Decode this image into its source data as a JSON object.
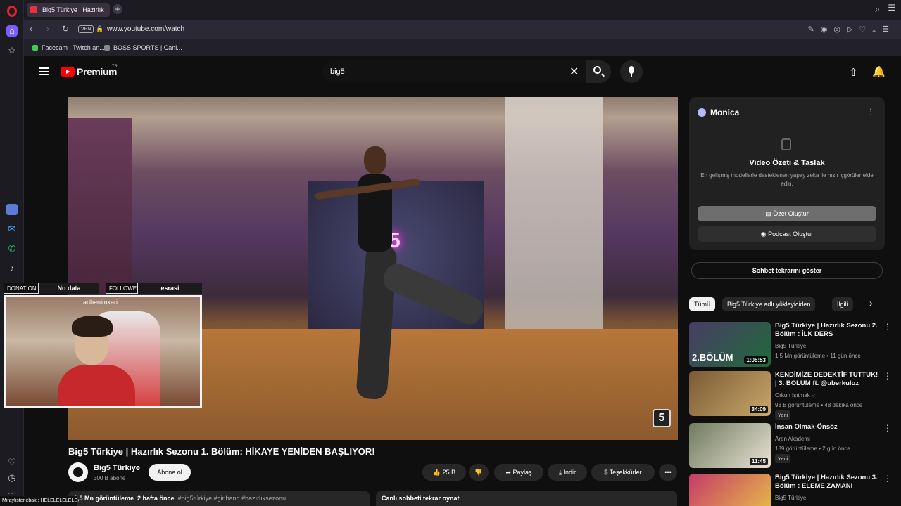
{
  "browser": {
    "tab_title": "Big5 Türkiye | Hazırlık",
    "vpn_label": "VPN",
    "url": "www.youtube.com/watch",
    "bookmarks": [
      {
        "label": "Facecam | Twitch an...",
        "color": "#3ccf4e"
      },
      {
        "label": "BOSS SPORTS | Canl...",
        "color": "#888888"
      }
    ]
  },
  "youtube": {
    "logo_text": "Premium",
    "logo_region": "TR",
    "search_value": "big5",
    "video": {
      "title": "Big5 Türkiye | Hazırlık Sezonu 1. Bölüm: HİKAYE YENİDEN BAŞLIYOR!",
      "channel": "Big5 Türkiye",
      "subscribers": "300 B abone",
      "subscribe_label": "Abone ol",
      "likes": "25 B",
      "share_label": "Paylaş",
      "download_label": "İndir",
      "thanks_label": "Teşekkürler",
      "views": "1,5 Mn görüntüleme",
      "age": "2 hafta önce",
      "tags": "#big5türkiye #girlband #hazırlıksezonu",
      "chat_replay_bar": "Canlı sohbeti tekrar oynat",
      "neon_sign": "5",
      "watermark": "5"
    },
    "monica": {
      "name": "Monica",
      "heading": "Video Özeti & Taslak",
      "description": "En gelişmiş modellerle desteklenen yapay zeka ile hızlı içgörüler elde edin.",
      "summary_button": "Özet Oluştur",
      "podcast_button": "Podcast Oluştur"
    },
    "chat_replay_button": "Sohbet tekrarını göster",
    "chips": [
      "Tümü",
      "Big5 Türkiye adlı yükleyiciden",
      "İlgili"
    ],
    "recommendations": [
      {
        "title": "Big5 Türkiye | Hazırlık Sezonu 2. Bölüm : İLK DERS",
        "channel": "Big5 Türkiye",
        "stats": "1,5 Mn görüntüleme • 11 gün önce",
        "duration": "1:05:53",
        "badge": "",
        "thumb_text": "2.BÖLÜM",
        "thumb_colors": [
          "#4a3c66",
          "#1f6a3a"
        ]
      },
      {
        "title": "KENDİMİZE DEDEKTİF TUTTUK! | 3. BÖLÜM ft. @uberkuloz",
        "channel": "Orkun Işıtmak ✓",
        "stats": "93 B görüntüleme • 48 dakika önce",
        "duration": "34:09",
        "badge": "Yeni",
        "thumb_text": "",
        "thumb_colors": [
          "#7a5a34",
          "#c9a86a"
        ]
      },
      {
        "title": "İnsan Olmak-Önsöz",
        "channel": "Aren Akademi",
        "stats": "189 görüntüleme • 2 gün önce",
        "duration": "11:45",
        "badge": "Yeni",
        "thumb_text": "",
        "thumb_colors": [
          "#6f7a5c",
          "#e8e2d6"
        ]
      },
      {
        "title": "Big5 Türkiye | Hazırlık Sezonu 3. Bölüm : ELEME ZAMANI",
        "channel": "Big5 Türkiye",
        "stats": "",
        "duration": "",
        "badge": "",
        "thumb_text": "",
        "thumb_colors": [
          "#c43a6a",
          "#e8c246"
        ]
      }
    ]
  },
  "stream_overlay": {
    "donation_label": "DONATION",
    "donation_value": "No data",
    "follower_label": "FOLLOWER",
    "follower_value": "esrasi",
    "streamer_name": "aribenimkari",
    "ticker": "Miraylistenebak : HELELELELELE"
  }
}
